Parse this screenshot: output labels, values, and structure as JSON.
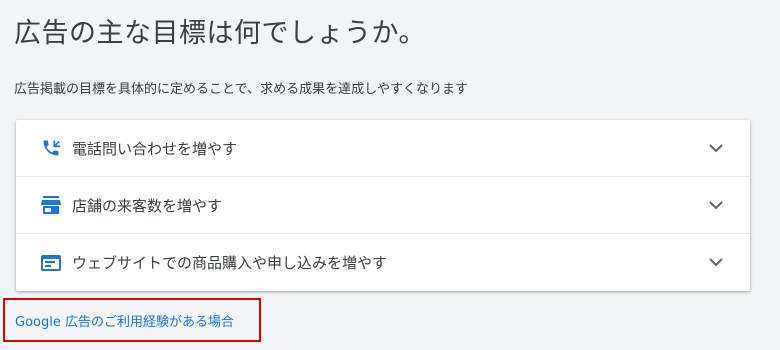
{
  "header": {
    "title": "広告の主な目標は何でしょうか。",
    "subtitle": "広告掲載の目標を具体的に定めることで、求める成果を達成しやすくなります"
  },
  "goals": [
    {
      "label": "電話問い合わせを増やす",
      "icon": "phone-call-icon"
    },
    {
      "label": "店舗の来客数を増やす",
      "icon": "storefront-icon"
    },
    {
      "label": "ウェブサイトでの商品購入や申し込みを増やす",
      "icon": "web-asset-icon"
    }
  ],
  "footer": {
    "experience_link": "Google 広告のご利用経験がある場合"
  },
  "colors": {
    "accent": "#1a73e8",
    "highlight_border": "#e50000",
    "background": "#f1f3f4"
  }
}
